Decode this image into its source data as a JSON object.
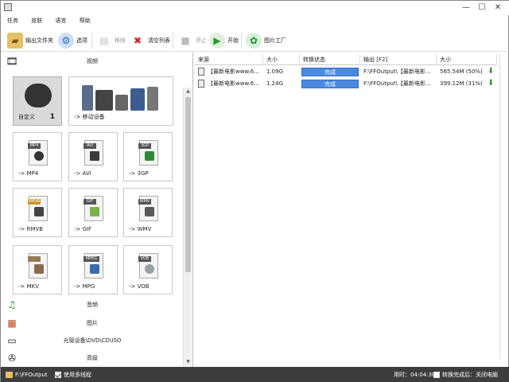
{
  "window": {
    "minimize": "—",
    "maximize": "☐",
    "close": "✕"
  },
  "menu": [
    "任务",
    "皮肤",
    "语言",
    "帮助"
  ],
  "toolbar": {
    "output_folder": "输出文件夹",
    "options": "选项",
    "remove": "移除",
    "clear_list": "清空列表",
    "stop": "停止",
    "start": "开始",
    "pic_factory": "图片工厂"
  },
  "categories": {
    "video": "视频",
    "audio": "音频",
    "picture": "图片",
    "rom": "光驱设备\\DVD\\CD\\ISO",
    "advanced": "高级"
  },
  "tiles": [
    {
      "label": "自定义",
      "count": "1",
      "tag": ""
    },
    {
      "label": "-> 移动设备",
      "tag": ""
    },
    {
      "label": "-> MP4",
      "tag": "MP4"
    },
    {
      "label": "-> AVI",
      "tag": "AVI"
    },
    {
      "label": "-> 3GP",
      "tag": "3GP"
    },
    {
      "label": "-> RMVB",
      "tag": "RMVB"
    },
    {
      "label": "-> GIF",
      "tag": "GIF"
    },
    {
      "label": "-> WMV",
      "tag": "WMV"
    },
    {
      "label": "-> MKV",
      "tag": ""
    },
    {
      "label": "-> MPG",
      "tag": "MPEG"
    },
    {
      "label": "-> VOB",
      "tag": "VOB"
    }
  ],
  "table": {
    "headers": [
      "来源",
      "大小",
      "转换状态",
      "输出 [F2]",
      "大小"
    ],
    "rows": [
      {
        "source": "【最新电影www.6...",
        "size": "1.09G",
        "status": "完成",
        "output": "F:\\FFOutput\\【最新电影...",
        "out_size": "565.54M  (50%)"
      },
      {
        "source": "【最新电影www.6...",
        "size": "1.24G",
        "status": "完成",
        "output": "F:\\FFOutput\\【最新电影...",
        "out_size": "399.12M  (31%)"
      }
    ]
  },
  "statusbar": {
    "output_path": "F:\\FFOutput",
    "multithread": "使用多线程",
    "elapsed": "用时：04:04:30",
    "shutdown": "转换完成后：关闭电脑"
  }
}
